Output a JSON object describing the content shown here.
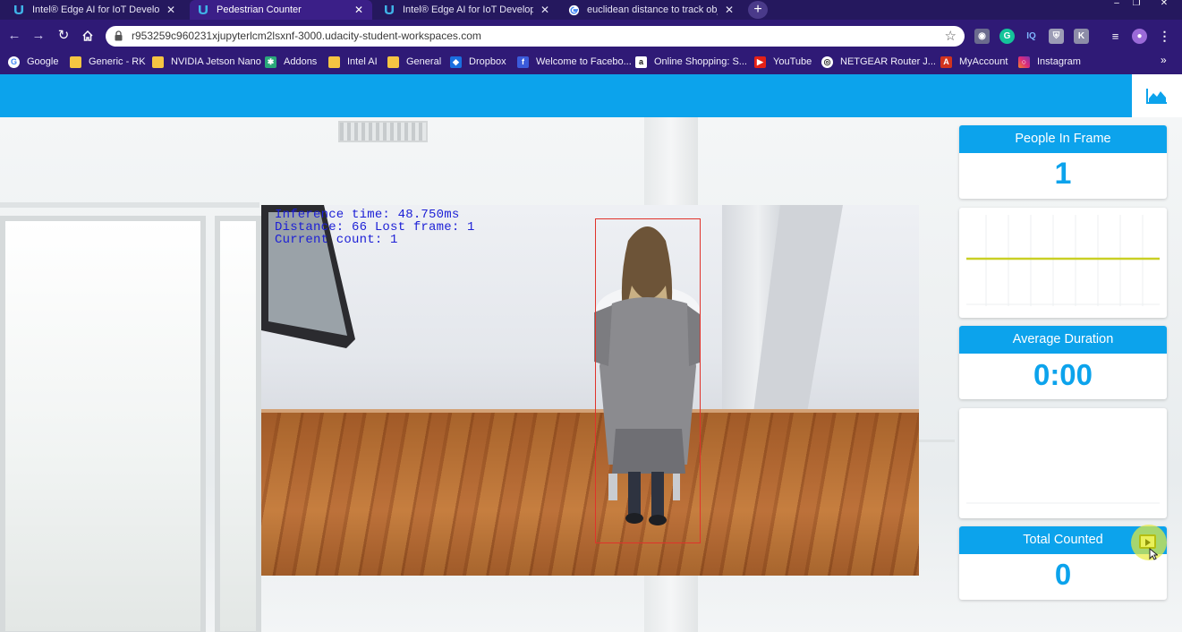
{
  "browser": {
    "tabs": [
      {
        "label": "Intel® Edge AI for IoT Developers",
        "icon": "udacity-icon",
        "active": false
      },
      {
        "label": "Pedestrian Counter",
        "icon": "udacity-icon",
        "active": true
      },
      {
        "label": "Intel® Edge AI for IoT Developers",
        "icon": "udacity-icon",
        "active": false
      },
      {
        "label": "euclidean distance to track object",
        "icon": "google-icon",
        "active": false
      }
    ],
    "close_glyph": "✕",
    "new_tab_glyph": "+",
    "window_controls": [
      "–",
      "❐",
      "✕"
    ],
    "url": "r953259c960231xjupyterlcm2lsxnf-3000.udacity-student-workspaces.com",
    "bookmarks": [
      {
        "label": "Google",
        "icon": "google-icon"
      },
      {
        "label": "Generic - RK",
        "icon": "folder-icon"
      },
      {
        "label": "NVIDIA Jetson Nano",
        "icon": "folder-icon"
      },
      {
        "label": "Addons",
        "icon": "puzzle-icon"
      },
      {
        "label": "Intel AI",
        "icon": "folder-icon"
      },
      {
        "label": "General",
        "icon": "folder-icon"
      },
      {
        "label": "Dropbox",
        "icon": "dropbox-icon"
      },
      {
        "label": "Welcome to Facebo...",
        "icon": "facebook-icon"
      },
      {
        "label": "Online Shopping: S...",
        "icon": "amazon-icon"
      },
      {
        "label": "YouTube",
        "icon": "youtube-icon"
      },
      {
        "label": "NETGEAR Router J...",
        "icon": "globe-icon"
      },
      {
        "label": "MyAccount",
        "icon": "myaccount-icon"
      },
      {
        "label": "Instagram",
        "icon": "instagram-icon"
      }
    ],
    "more_glyph": "»"
  },
  "app": {
    "accent_color": "#0ca3ec",
    "video": {
      "overlay_lines": [
        "Inference time: 48.750ms",
        "Distance: 66 Lost frame: 1",
        "Current count: 1"
      ],
      "bbox_color": "#e0332b"
    },
    "cards": {
      "people_in_frame": {
        "title": "People In Frame",
        "value": "1"
      },
      "average_duration": {
        "title": "Average Duration",
        "value": "0:00"
      },
      "total_counted": {
        "title": "Total Counted",
        "value": "0"
      }
    },
    "people_chart_line_color": "#c9cf24"
  }
}
